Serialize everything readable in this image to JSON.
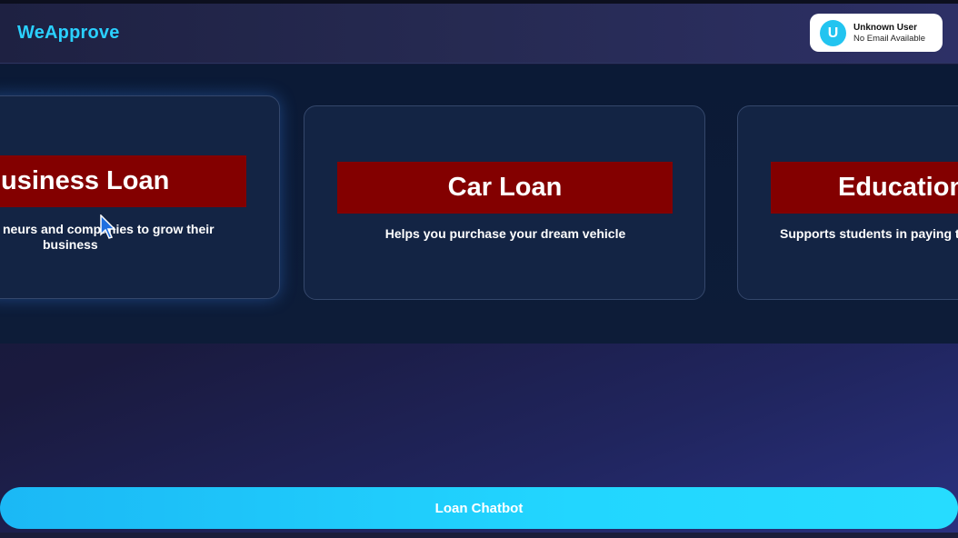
{
  "app": {
    "name": "WeApprove"
  },
  "user": {
    "initial": "U",
    "name": "Unknown User",
    "email": "No Email Available"
  },
  "loans": [
    {
      "title": "Business Loan",
      "description": "Supports entrepreneurs and companies to grow their business",
      "visible_title": "usiness Loan",
      "visible_desc_line1": "neurs and companies to grow their",
      "visible_desc_line2": "business"
    },
    {
      "title": "Car Loan",
      "description": "Helps you purchase your dream vehicle"
    },
    {
      "title": "Education",
      "visible_title": "Education",
      "visible_desc": "Supports students in paying t"
    }
  ],
  "chatbot": {
    "label": "Loan Chatbot"
  },
  "colors": {
    "brand": "#2ad0ff",
    "card_title_bg": "#830000",
    "card_bg": "#132444",
    "button_bg": "#22d6ff"
  }
}
